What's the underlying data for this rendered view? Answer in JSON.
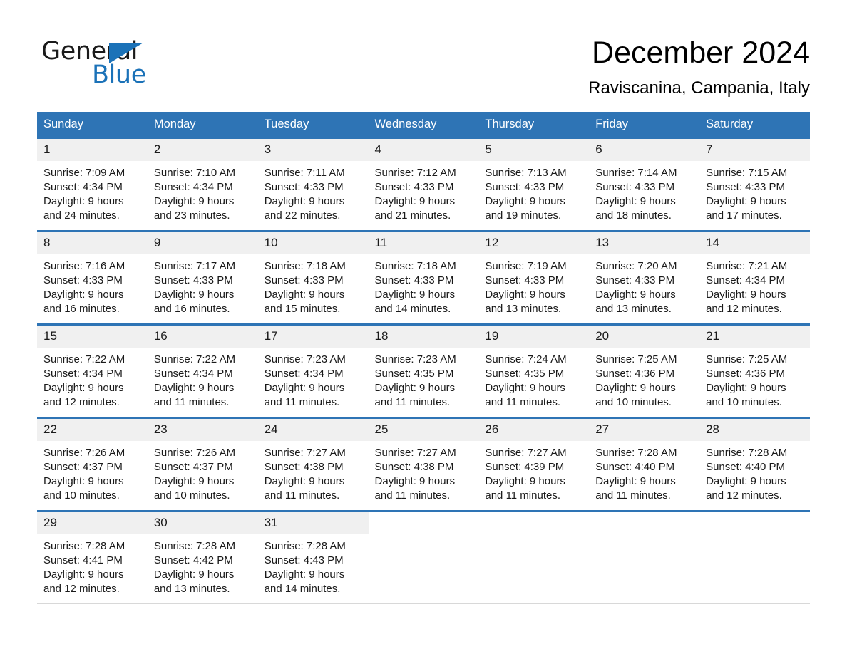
{
  "brand": {
    "word_one": "General",
    "word_two": "Blue",
    "accent_color": "#1b72b8"
  },
  "header": {
    "month_title": "December 2024",
    "location": "Raviscanina, Campania, Italy"
  },
  "calendar": {
    "header_color": "#2e74b5",
    "daynum_band_color": "#f0f0f0",
    "weekday_headers": [
      "Sunday",
      "Monday",
      "Tuesday",
      "Wednesday",
      "Thursday",
      "Friday",
      "Saturday"
    ],
    "weeks": [
      [
        {
          "day": "1",
          "sunrise": "Sunrise: 7:09 AM",
          "sunset": "Sunset: 4:34 PM",
          "daylight_1": "Daylight: 9 hours",
          "daylight_2": "and 24 minutes."
        },
        {
          "day": "2",
          "sunrise": "Sunrise: 7:10 AM",
          "sunset": "Sunset: 4:34 PM",
          "daylight_1": "Daylight: 9 hours",
          "daylight_2": "and 23 minutes."
        },
        {
          "day": "3",
          "sunrise": "Sunrise: 7:11 AM",
          "sunset": "Sunset: 4:33 PM",
          "daylight_1": "Daylight: 9 hours",
          "daylight_2": "and 22 minutes."
        },
        {
          "day": "4",
          "sunrise": "Sunrise: 7:12 AM",
          "sunset": "Sunset: 4:33 PM",
          "daylight_1": "Daylight: 9 hours",
          "daylight_2": "and 21 minutes."
        },
        {
          "day": "5",
          "sunrise": "Sunrise: 7:13 AM",
          "sunset": "Sunset: 4:33 PM",
          "daylight_1": "Daylight: 9 hours",
          "daylight_2": "and 19 minutes."
        },
        {
          "day": "6",
          "sunrise": "Sunrise: 7:14 AM",
          "sunset": "Sunset: 4:33 PM",
          "daylight_1": "Daylight: 9 hours",
          "daylight_2": "and 18 minutes."
        },
        {
          "day": "7",
          "sunrise": "Sunrise: 7:15 AM",
          "sunset": "Sunset: 4:33 PM",
          "daylight_1": "Daylight: 9 hours",
          "daylight_2": "and 17 minutes."
        }
      ],
      [
        {
          "day": "8",
          "sunrise": "Sunrise: 7:16 AM",
          "sunset": "Sunset: 4:33 PM",
          "daylight_1": "Daylight: 9 hours",
          "daylight_2": "and 16 minutes."
        },
        {
          "day": "9",
          "sunrise": "Sunrise: 7:17 AM",
          "sunset": "Sunset: 4:33 PM",
          "daylight_1": "Daylight: 9 hours",
          "daylight_2": "and 16 minutes."
        },
        {
          "day": "10",
          "sunrise": "Sunrise: 7:18 AM",
          "sunset": "Sunset: 4:33 PM",
          "daylight_1": "Daylight: 9 hours",
          "daylight_2": "and 15 minutes."
        },
        {
          "day": "11",
          "sunrise": "Sunrise: 7:18 AM",
          "sunset": "Sunset: 4:33 PM",
          "daylight_1": "Daylight: 9 hours",
          "daylight_2": "and 14 minutes."
        },
        {
          "day": "12",
          "sunrise": "Sunrise: 7:19 AM",
          "sunset": "Sunset: 4:33 PM",
          "daylight_1": "Daylight: 9 hours",
          "daylight_2": "and 13 minutes."
        },
        {
          "day": "13",
          "sunrise": "Sunrise: 7:20 AM",
          "sunset": "Sunset: 4:33 PM",
          "daylight_1": "Daylight: 9 hours",
          "daylight_2": "and 13 minutes."
        },
        {
          "day": "14",
          "sunrise": "Sunrise: 7:21 AM",
          "sunset": "Sunset: 4:34 PM",
          "daylight_1": "Daylight: 9 hours",
          "daylight_2": "and 12 minutes."
        }
      ],
      [
        {
          "day": "15",
          "sunrise": "Sunrise: 7:22 AM",
          "sunset": "Sunset: 4:34 PM",
          "daylight_1": "Daylight: 9 hours",
          "daylight_2": "and 12 minutes."
        },
        {
          "day": "16",
          "sunrise": "Sunrise: 7:22 AM",
          "sunset": "Sunset: 4:34 PM",
          "daylight_1": "Daylight: 9 hours",
          "daylight_2": "and 11 minutes."
        },
        {
          "day": "17",
          "sunrise": "Sunrise: 7:23 AM",
          "sunset": "Sunset: 4:34 PM",
          "daylight_1": "Daylight: 9 hours",
          "daylight_2": "and 11 minutes."
        },
        {
          "day": "18",
          "sunrise": "Sunrise: 7:23 AM",
          "sunset": "Sunset: 4:35 PM",
          "daylight_1": "Daylight: 9 hours",
          "daylight_2": "and 11 minutes."
        },
        {
          "day": "19",
          "sunrise": "Sunrise: 7:24 AM",
          "sunset": "Sunset: 4:35 PM",
          "daylight_1": "Daylight: 9 hours",
          "daylight_2": "and 11 minutes."
        },
        {
          "day": "20",
          "sunrise": "Sunrise: 7:25 AM",
          "sunset": "Sunset: 4:36 PM",
          "daylight_1": "Daylight: 9 hours",
          "daylight_2": "and 10 minutes."
        },
        {
          "day": "21",
          "sunrise": "Sunrise: 7:25 AM",
          "sunset": "Sunset: 4:36 PM",
          "daylight_1": "Daylight: 9 hours",
          "daylight_2": "and 10 minutes."
        }
      ],
      [
        {
          "day": "22",
          "sunrise": "Sunrise: 7:26 AM",
          "sunset": "Sunset: 4:37 PM",
          "daylight_1": "Daylight: 9 hours",
          "daylight_2": "and 10 minutes."
        },
        {
          "day": "23",
          "sunrise": "Sunrise: 7:26 AM",
          "sunset": "Sunset: 4:37 PM",
          "daylight_1": "Daylight: 9 hours",
          "daylight_2": "and 10 minutes."
        },
        {
          "day": "24",
          "sunrise": "Sunrise: 7:27 AM",
          "sunset": "Sunset: 4:38 PM",
          "daylight_1": "Daylight: 9 hours",
          "daylight_2": "and 11 minutes."
        },
        {
          "day": "25",
          "sunrise": "Sunrise: 7:27 AM",
          "sunset": "Sunset: 4:38 PM",
          "daylight_1": "Daylight: 9 hours",
          "daylight_2": "and 11 minutes."
        },
        {
          "day": "26",
          "sunrise": "Sunrise: 7:27 AM",
          "sunset": "Sunset: 4:39 PM",
          "daylight_1": "Daylight: 9 hours",
          "daylight_2": "and 11 minutes."
        },
        {
          "day": "27",
          "sunrise": "Sunrise: 7:28 AM",
          "sunset": "Sunset: 4:40 PM",
          "daylight_1": "Daylight: 9 hours",
          "daylight_2": "and 11 minutes."
        },
        {
          "day": "28",
          "sunrise": "Sunrise: 7:28 AM",
          "sunset": "Sunset: 4:40 PM",
          "daylight_1": "Daylight: 9 hours",
          "daylight_2": "and 12 minutes."
        }
      ],
      [
        {
          "day": "29",
          "sunrise": "Sunrise: 7:28 AM",
          "sunset": "Sunset: 4:41 PM",
          "daylight_1": "Daylight: 9 hours",
          "daylight_2": "and 12 minutes."
        },
        {
          "day": "30",
          "sunrise": "Sunrise: 7:28 AM",
          "sunset": "Sunset: 4:42 PM",
          "daylight_1": "Daylight: 9 hours",
          "daylight_2": "and 13 minutes."
        },
        {
          "day": "31",
          "sunrise": "Sunrise: 7:28 AM",
          "sunset": "Sunset: 4:43 PM",
          "daylight_1": "Daylight: 9 hours",
          "daylight_2": "and 14 minutes."
        },
        {
          "day": "",
          "sunrise": "",
          "sunset": "",
          "daylight_1": "",
          "daylight_2": ""
        },
        {
          "day": "",
          "sunrise": "",
          "sunset": "",
          "daylight_1": "",
          "daylight_2": ""
        },
        {
          "day": "",
          "sunrise": "",
          "sunset": "",
          "daylight_1": "",
          "daylight_2": ""
        },
        {
          "day": "",
          "sunrise": "",
          "sunset": "",
          "daylight_1": "",
          "daylight_2": ""
        }
      ]
    ]
  }
}
